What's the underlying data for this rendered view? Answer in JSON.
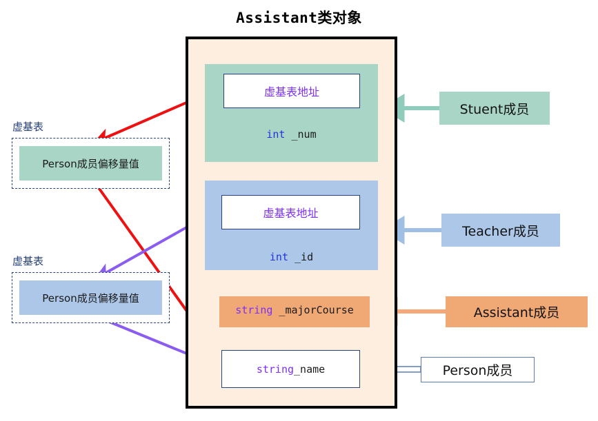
{
  "title": "Assistant类对象",
  "object": {
    "student_block": {
      "vbptr_label": "虚基表地址",
      "field_type": "int",
      "field_name": " _num"
    },
    "teacher_block": {
      "vbptr_label": "虚基表地址",
      "field_type": "int",
      "field_name": " _id"
    },
    "assistant_block": {
      "field_type": "string",
      "field_name": " _majorCourse"
    },
    "person_block": {
      "field_type": "string",
      "field_name": " _name"
    }
  },
  "vbtables": [
    {
      "label": "虚基表",
      "entry": "Person成员偏移量值"
    },
    {
      "label": "虚基表",
      "entry": "Person成员偏移量值"
    }
  ],
  "callouts": {
    "student": "Stuent成员",
    "teacher": "Teacher成员",
    "assistant": "Assistant成员",
    "person": "Person成员"
  },
  "colors": {
    "student_green": "#a8d5c5",
    "teacher_blue": "#acc7e8",
    "assistant_orange": "#f0a875",
    "object_bg": "#fdeee0",
    "object_border": "#000000",
    "vbptr_text": "#7b2ff7",
    "keyword_blue": "#2233dd",
    "label_navy": "#26417a",
    "arrow_red": "#ee1111",
    "arrow_purple": "#8a5cf0",
    "arrow_person_outline": "#5b7bb5"
  }
}
